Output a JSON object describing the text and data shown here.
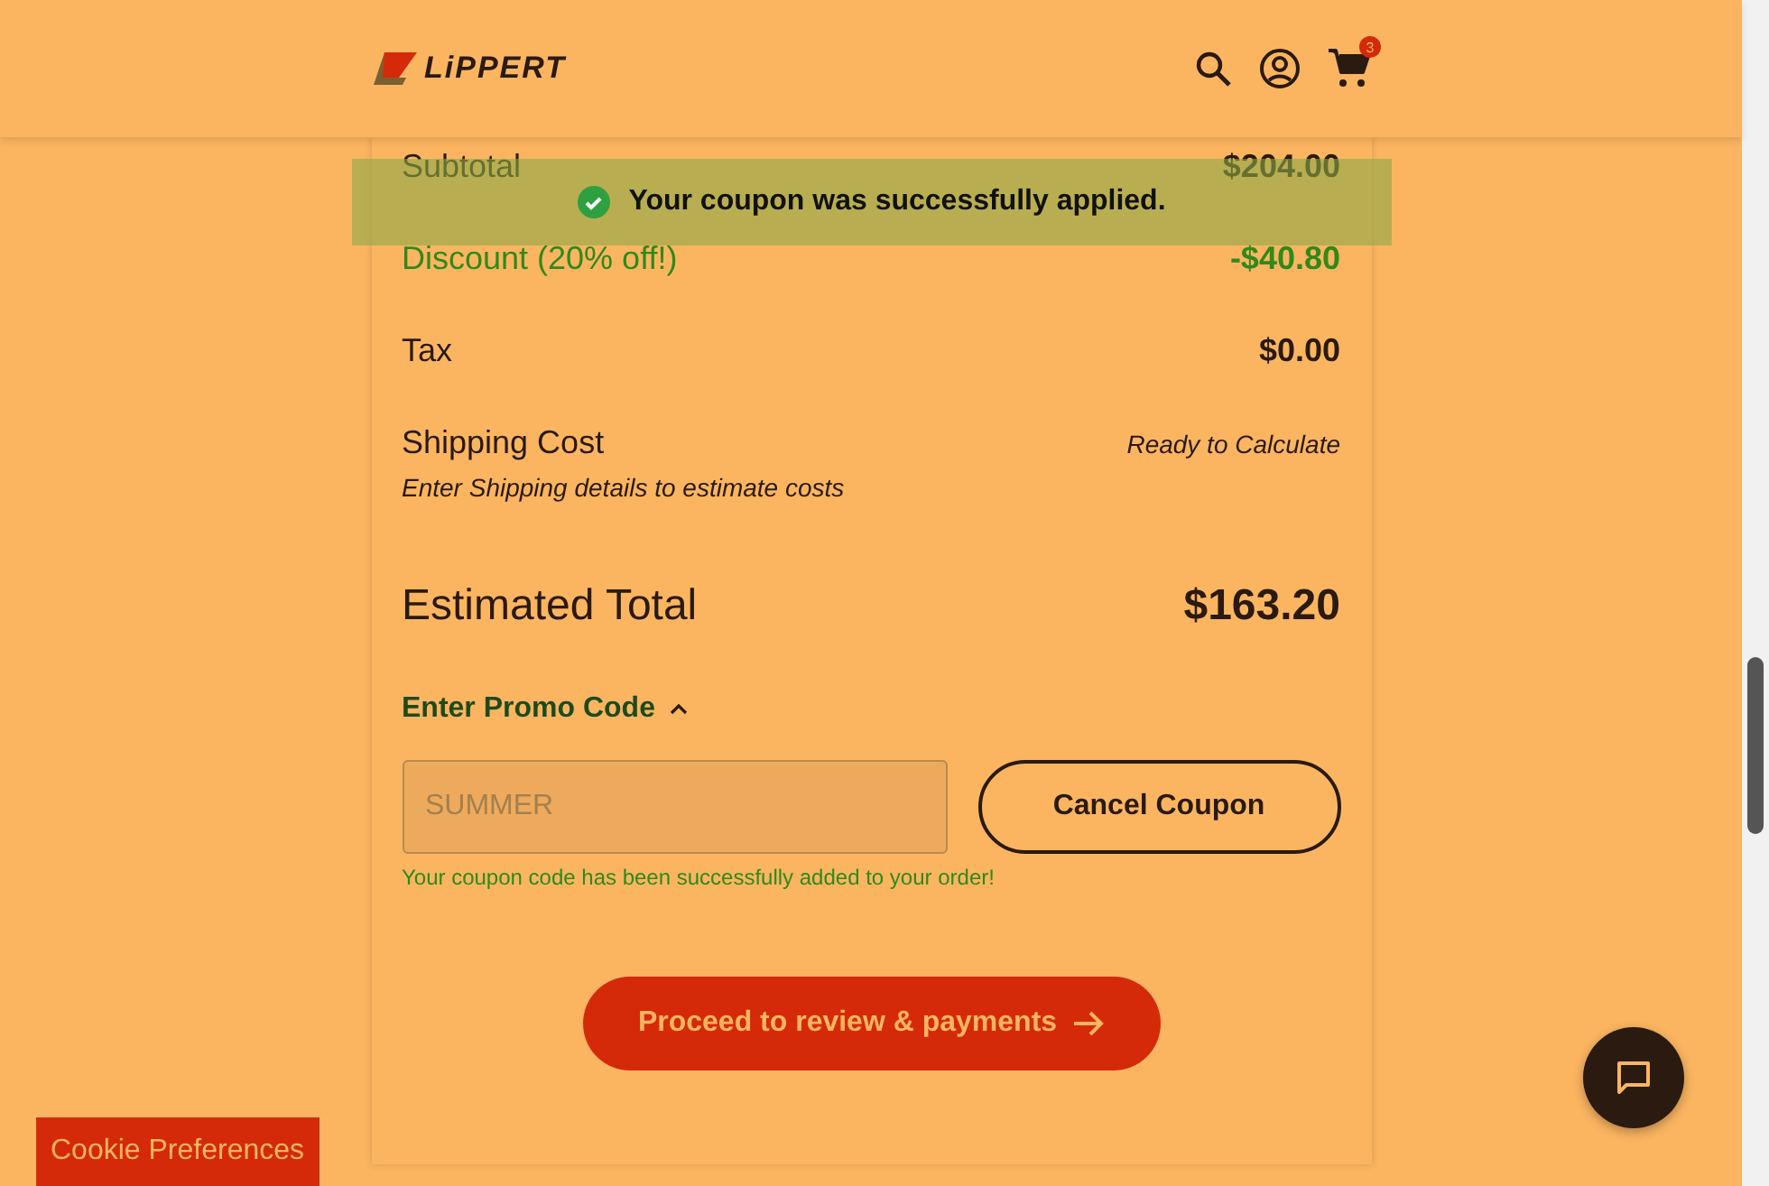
{
  "header": {
    "brand": "LiPPERT",
    "cart_count": "3"
  },
  "toast": {
    "message": "Your coupon was successfully applied."
  },
  "summary": [
    {
      "kind": "line",
      "label": "Subtotal",
      "value": "$204.00"
    },
    {
      "kind": "discount",
      "label": "Discount (20% off!)",
      "value": "-$40.80"
    },
    {
      "kind": "line",
      "label": "Tax",
      "value": "$0.00"
    },
    {
      "kind": "shipping",
      "label": "Shipping Cost",
      "value": "Ready to Calculate",
      "note": "Enter Shipping details to estimate costs"
    },
    {
      "kind": "total",
      "label": "Estimated Total",
      "value": "$163.20"
    }
  ],
  "promo": {
    "title": "Enter Promo Code",
    "expanded": true,
    "placeholder": "SUMMER",
    "button": "Cancel Coupon",
    "message": "Your coupon code has been successfully added to your order!"
  },
  "checkout_button": "Proceed to review & payments",
  "cookie_button": "Cookie Preferences"
}
